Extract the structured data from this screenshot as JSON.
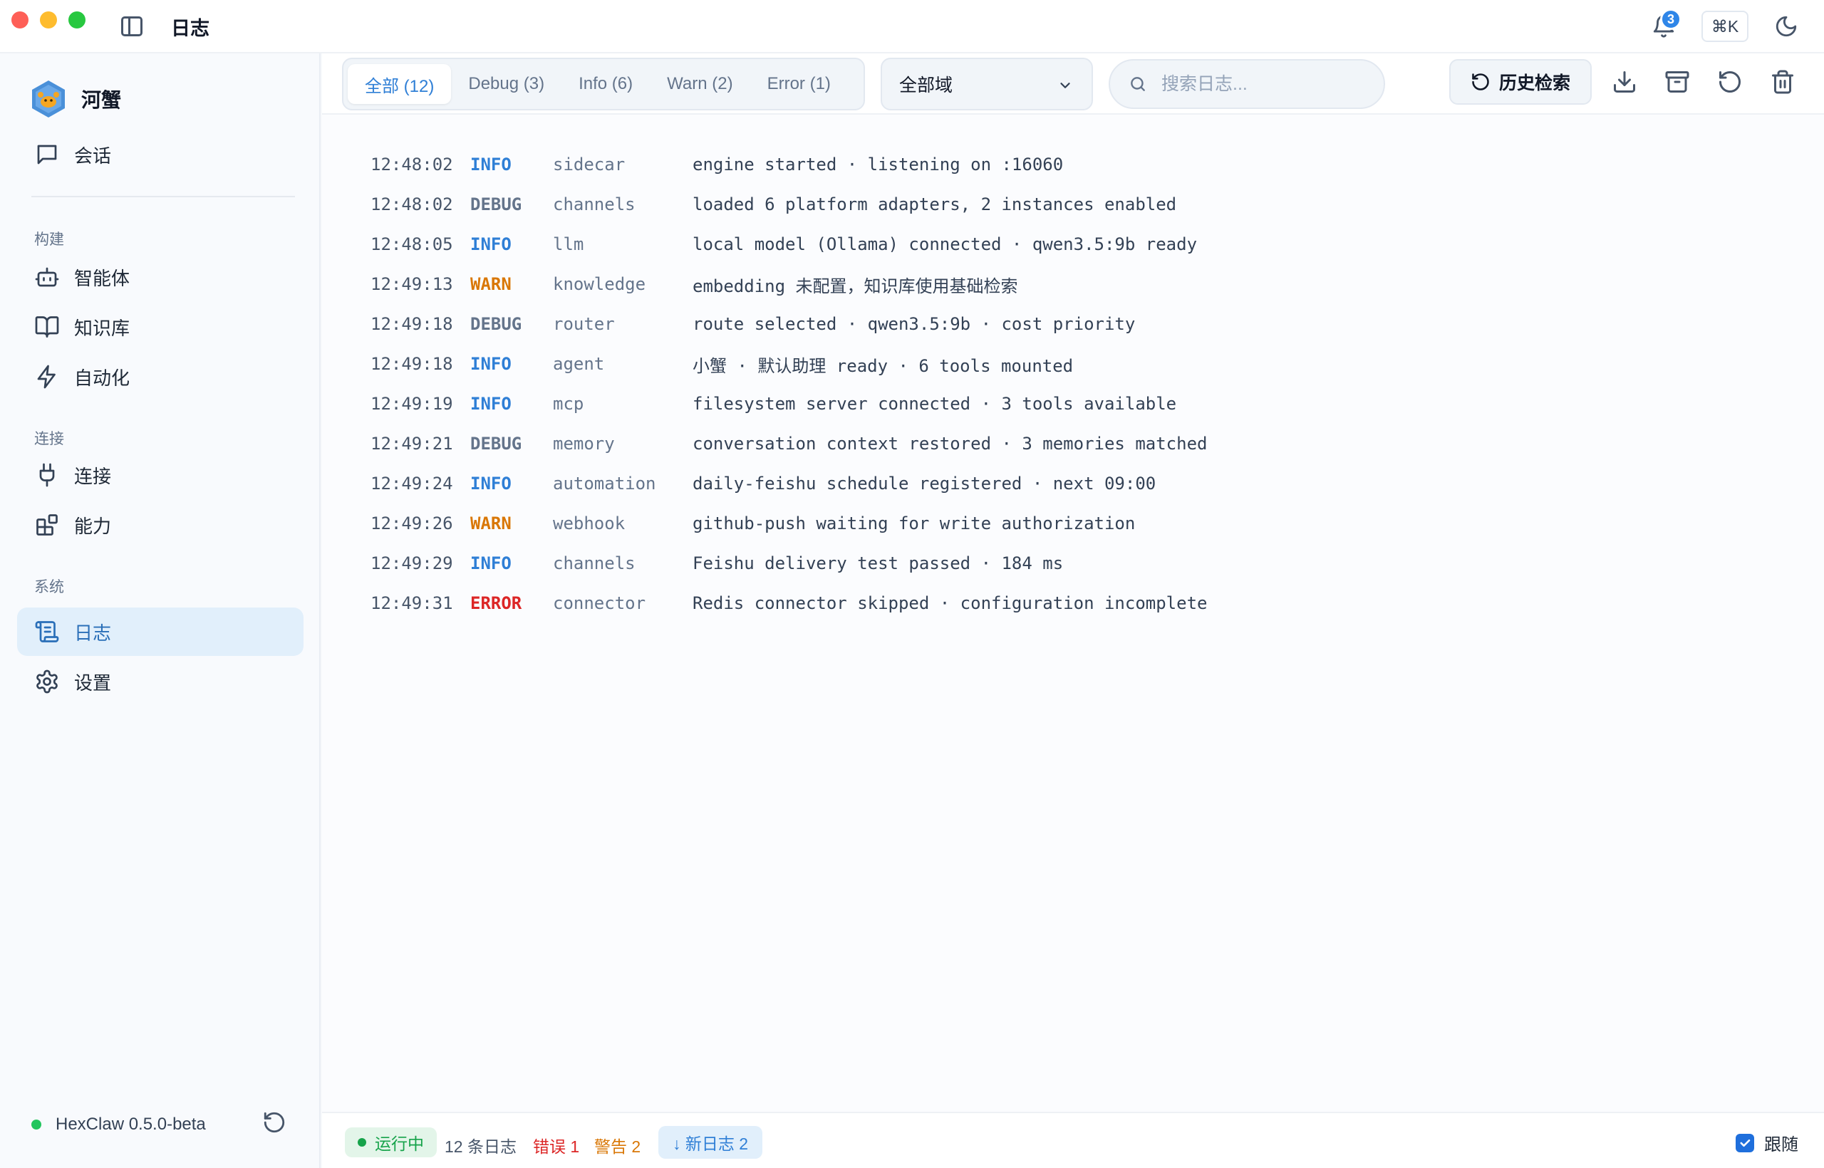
{
  "window": {
    "title": "日志"
  },
  "header": {
    "notification_count": "3",
    "shortcut": "⌘K"
  },
  "sidebar": {
    "brand": "河蟹",
    "chat": {
      "label": "会话",
      "icon": "chat-icon"
    },
    "sections": [
      {
        "label": "构建"
      },
      {
        "label": "连接"
      },
      {
        "label": "系统"
      }
    ],
    "items": [
      {
        "label": "智能体",
        "icon": "robot-icon"
      },
      {
        "label": "知识库",
        "icon": "book-icon"
      },
      {
        "label": "自动化",
        "icon": "lightning-icon"
      },
      {
        "label": "连接",
        "icon": "plug-icon"
      },
      {
        "label": "能力",
        "icon": "blocks-icon"
      },
      {
        "label": "日志",
        "icon": "scroll-icon",
        "active": true
      },
      {
        "label": "设置",
        "icon": "gear-icon"
      }
    ],
    "version": "HexClaw 0.5.0-beta"
  },
  "toolbar": {
    "tabs": [
      {
        "label": "全部 (12)",
        "active": true
      },
      {
        "label": "Debug (3)"
      },
      {
        "label": "Info (6)"
      },
      {
        "label": "Warn (2)"
      },
      {
        "label": "Error (1)"
      }
    ],
    "domain_select": "全部域",
    "search_placeholder": "搜索日志...",
    "history_label": "历史检索"
  },
  "logs": [
    {
      "time": "12:48:02",
      "level": "INFO",
      "source": "sidecar",
      "message": "engine started · listening on :16060"
    },
    {
      "time": "12:48:02",
      "level": "DEBUG",
      "source": "channels",
      "message": "loaded 6 platform adapters, 2 instances enabled"
    },
    {
      "time": "12:48:05",
      "level": "INFO",
      "source": "llm",
      "message": "local model (Ollama) connected · qwen3.5:9b ready"
    },
    {
      "time": "12:49:13",
      "level": "WARN",
      "source": "knowledge",
      "message": "embedding 未配置，知识库使用基础检索"
    },
    {
      "time": "12:49:18",
      "level": "DEBUG",
      "source": "router",
      "message": "route selected · qwen3.5:9b · cost priority"
    },
    {
      "time": "12:49:18",
      "level": "INFO",
      "source": "agent",
      "message": "小蟹 · 默认助理 ready · 6 tools mounted"
    },
    {
      "time": "12:49:19",
      "level": "INFO",
      "source": "mcp",
      "message": "filesystem server connected · 3 tools available"
    },
    {
      "time": "12:49:21",
      "level": "DEBUG",
      "source": "memory",
      "message": "conversation context restored · 3 memories matched"
    },
    {
      "time": "12:49:24",
      "level": "INFO",
      "source": "automation",
      "message": "daily-feishu schedule registered · next 09:00"
    },
    {
      "time": "12:49:26",
      "level": "WARN",
      "source": "webhook",
      "message": "github-push waiting for write authorization"
    },
    {
      "time": "12:49:29",
      "level": "INFO",
      "source": "channels",
      "message": "Feishu delivery test passed · 184 ms"
    },
    {
      "time": "12:49:31",
      "level": "ERROR",
      "source": "connector",
      "message": "Redis connector skipped · configuration incomplete"
    }
  ],
  "status": {
    "running": "运行中",
    "count": "12 条日志",
    "errors": "错误 1",
    "warnings": "警告 2",
    "new_logs": "↓ 新日志 2",
    "follow": "跟随"
  },
  "colors": {
    "accent": "#2f7fd6",
    "info": "#2f7fd6",
    "debug": "#64748b",
    "warn": "#d97706",
    "error": "#dc2626",
    "running": "#16a34a"
  }
}
